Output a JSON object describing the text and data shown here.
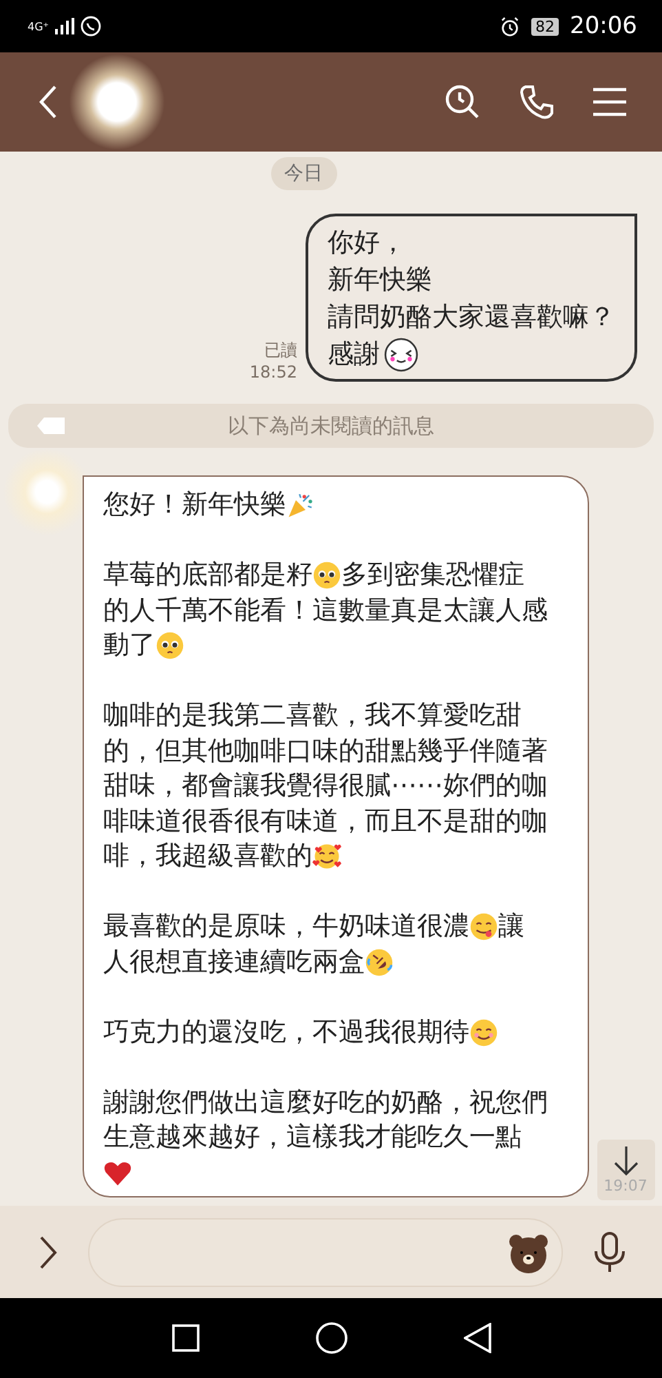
{
  "status_bar": {
    "network": "4G⁺",
    "battery": "82",
    "time": "20:06"
  },
  "day_label": "今日",
  "sent": {
    "read_label": "已讀",
    "time": "18:52",
    "lines": [
      [
        {
          "kind": "text",
          "text": "你好，"
        }
      ],
      [
        {
          "kind": "text",
          "text": "新年快樂"
        }
      ],
      [
        {
          "kind": "text",
          "text": "請問奶酪大家還喜歡嘛？"
        }
      ],
      [
        {
          "kind": "text",
          "text": "感謝"
        },
        {
          "kind": "squint-face"
        }
      ]
    ]
  },
  "unread_label": "以下為尚未閱讀的訊息",
  "received": {
    "paragraphs": [
      [
        [
          {
            "kind": "text",
            "text": "您好！新年快樂"
          },
          {
            "kind": "party-popper"
          }
        ]
      ],
      [
        [
          {
            "kind": "text",
            "text": "草莓的底部都是籽"
          },
          {
            "kind": "pleading-face"
          },
          {
            "kind": "text",
            "text": "多到密集恐懼症"
          }
        ],
        [
          {
            "kind": "text",
            "text": "的人千萬不能看！這數量真是太讓人感"
          }
        ],
        [
          {
            "kind": "text",
            "text": "動了"
          },
          {
            "kind": "pleading-face"
          }
        ]
      ],
      [
        [
          {
            "kind": "text",
            "text": "咖啡的是我第二喜歡，我不算愛吃甜"
          }
        ],
        [
          {
            "kind": "text",
            "text": "的，但其他咖啡口味的甜點幾乎伴隨著"
          }
        ],
        [
          {
            "kind": "text",
            "text": "甜味，都會讓我覺得很膩⋯⋯妳們的咖"
          }
        ],
        [
          {
            "kind": "text",
            "text": "啡味道很香很有味道，而且不是甜的咖"
          }
        ],
        [
          {
            "kind": "text",
            "text": "啡，我超級喜歡的"
          },
          {
            "kind": "hearts-face"
          }
        ]
      ],
      [
        [
          {
            "kind": "text",
            "text": "最喜歡的是原味，牛奶味道很濃"
          },
          {
            "kind": "savoring-face"
          },
          {
            "kind": "text",
            "text": "讓"
          }
        ],
        [
          {
            "kind": "text",
            "text": "人很想直接連續吃兩盒"
          },
          {
            "kind": "laughing-face"
          }
        ]
      ],
      [
        [
          {
            "kind": "text",
            "text": "巧克力的還沒吃，不過我很期待"
          },
          {
            "kind": "smiling-face"
          }
        ]
      ],
      [
        [
          {
            "kind": "text",
            "text": "謝謝您們做出這麼好吃的奶酪，祝您們"
          }
        ],
        [
          {
            "kind": "text",
            "text": "生意越來越好，這樣我才能吃久一點"
          }
        ],
        [
          {
            "kind": "heart"
          }
        ]
      ]
    ]
  },
  "scroll_time": "19:07"
}
